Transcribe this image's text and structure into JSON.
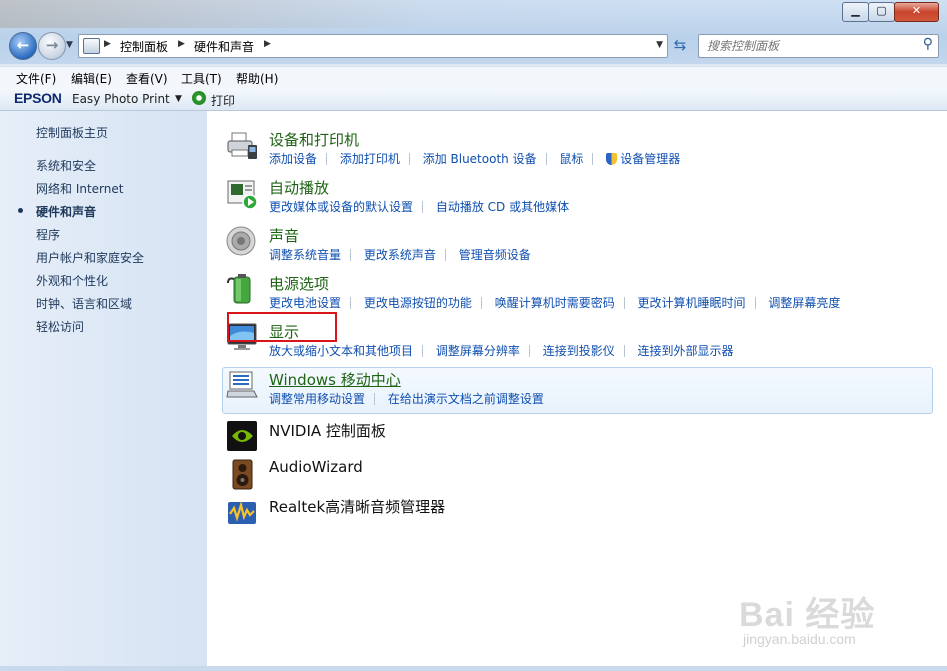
{
  "window": {
    "controls": {
      "minimize": "▁",
      "maximize": "▢",
      "close": "✕"
    }
  },
  "address_bar": {
    "crumbs": [
      "控制面板",
      "硬件和声音"
    ],
    "search_placeholder": "搜索控制面板"
  },
  "menu": [
    "文件(F)",
    "编辑(E)",
    "查看(V)",
    "工具(T)",
    "帮助(H)"
  ],
  "toolbar": {
    "brand": "EPSON",
    "app": "Easy Photo Print",
    "print": "打印"
  },
  "sidebar": {
    "items": [
      {
        "label": "控制面板主页",
        "active": false
      },
      {
        "label": "系统和安全",
        "active": false
      },
      {
        "label": "网络和 Internet",
        "active": false
      },
      {
        "label": "硬件和声音",
        "active": true
      },
      {
        "label": "程序",
        "active": false
      },
      {
        "label": "用户帐户和家庭安全",
        "active": false
      },
      {
        "label": "外观和个性化",
        "active": false
      },
      {
        "label": "时钟、语言和区域",
        "active": false
      },
      {
        "label": "轻松访问",
        "active": false
      }
    ]
  },
  "categories": [
    {
      "title": "设备和打印机",
      "icon": "printer-icon",
      "links": [
        "添加设备",
        "添加打印机",
        "添加 Bluetooth 设备",
        "鼠标",
        "设备管理器"
      ]
    },
    {
      "title": "自动播放",
      "icon": "autoplay-icon",
      "links": [
        "更改媒体或设备的默认设置",
        "自动播放 CD 或其他媒体"
      ]
    },
    {
      "title": "声音",
      "icon": "speaker-icon",
      "links": [
        "调整系统音量",
        "更改系统声音",
        "管理音频设备"
      ]
    },
    {
      "title": "电源选项",
      "icon": "battery-icon",
      "links": [
        "更改电池设置",
        "更改电源按钮的功能",
        "唤醒计算机时需要密码",
        "更改计算机睡眠时间",
        "调整屏幕亮度"
      ]
    },
    {
      "title": "显示",
      "icon": "display-icon",
      "links": [
        "放大或缩小文本和其他项目",
        "调整屏幕分辨率",
        "连接到投影仪",
        "连接到外部显示器"
      ]
    },
    {
      "title": "Windows 移动中心",
      "icon": "mobility-center-icon",
      "links": [
        "调整常用移动设置",
        "在给出演示文档之前调整设置"
      ]
    },
    {
      "title": "NVIDIA 控制面板",
      "icon": "nvidia-icon",
      "links": []
    },
    {
      "title": "AudioWizard",
      "icon": "audiowizard-icon",
      "links": []
    },
    {
      "title": "Realtek高清晰音频管理器",
      "icon": "realtek-icon",
      "links": []
    }
  ],
  "watermark": {
    "text": "Bai 经验",
    "sub": "jingyan.baidu.com"
  },
  "colors": {
    "category_title": "#1e6414",
    "link": "#0f4fb0",
    "sidebar_text": "#1e395b",
    "highlight_box": "#d9151a"
  }
}
